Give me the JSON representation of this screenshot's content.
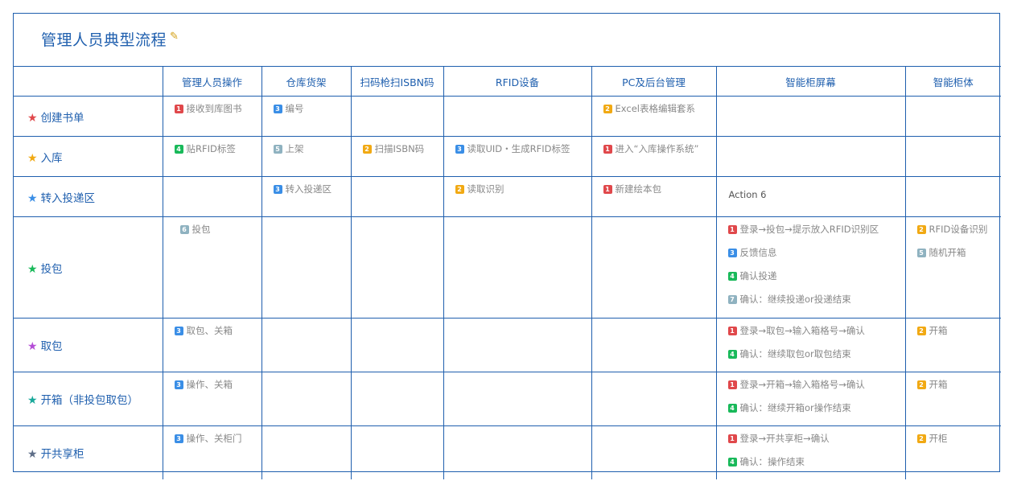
{
  "title": "管理人员典型流程",
  "columns": [
    "管理人员操作",
    "仓库货架",
    "扫码枪扫ISBN码",
    "RFID设备",
    "PC及后台管理",
    "智能柜屏幕",
    "智能柜体"
  ],
  "colors": {
    "red": "#e0484b",
    "orange": "#f1a913",
    "blue": "#3a8ee6",
    "green": "#19b95a",
    "grey": "#8fb2c0",
    "teal": "#19a89a",
    "purple": "#b44dd6",
    "slate": "#5e6e88"
  },
  "rows": [
    {
      "label": "创建书单",
      "star": "red",
      "cells": [
        [
          {
            "n": "1",
            "c": "red",
            "t": "接收到库图书"
          }
        ],
        [
          {
            "n": "3",
            "c": "blue",
            "t": "编号"
          }
        ],
        [],
        [],
        [
          {
            "n": "2",
            "c": "orange",
            "t": "Excel表格编辑套系"
          }
        ],
        [],
        []
      ]
    },
    {
      "label": "入库",
      "star": "orange",
      "cells": [
        [
          {
            "n": "4",
            "c": "green",
            "t": "贴RFID标签"
          }
        ],
        [
          {
            "n": "5",
            "c": "grey",
            "t": "上架"
          }
        ],
        [
          {
            "n": "2",
            "c": "orange",
            "t": "扫描ISBN码"
          }
        ],
        [
          {
            "n": "3",
            "c": "blue",
            "t": "读取UID・生成RFID标签"
          }
        ],
        [
          {
            "n": "1",
            "c": "red",
            "t": "进入“入库操作系统”"
          }
        ],
        [],
        []
      ]
    },
    {
      "label": "转入投递区",
      "star": "blue",
      "cells": [
        [],
        [
          {
            "n": "3",
            "c": "blue",
            "t": "转入投递区"
          }
        ],
        [],
        [
          {
            "n": "2",
            "c": "orange",
            "t": "读取识别"
          }
        ],
        [
          {
            "n": "1",
            "c": "red",
            "t": "新建绘本包"
          }
        ],
        [
          {
            "plain": "Action 6"
          }
        ],
        []
      ]
    },
    {
      "label": "投包",
      "star": "green",
      "cells": [
        [
          {
            "n": "6",
            "c": "grey",
            "t": "投包"
          }
        ],
        [],
        [],
        [],
        [],
        [
          {
            "n": "1",
            "c": "red",
            "t": "登录→投包→提示放入RFID识别区"
          },
          {
            "n": "3",
            "c": "blue",
            "t": "反馈信息"
          },
          {
            "n": "4",
            "c": "green",
            "t": "确认投递"
          },
          {
            "n": "7",
            "c": "grey",
            "t": "确认：继续投递or投递结束"
          }
        ],
        [
          {
            "n": "2",
            "c": "orange",
            "t": "RFID设备识别"
          },
          {
            "n": "5",
            "c": "grey",
            "t": "随机开箱"
          }
        ]
      ]
    },
    {
      "label": "取包",
      "star": "purple",
      "cells": [
        [
          {
            "n": "3",
            "c": "blue",
            "t": "取包、关箱"
          }
        ],
        [],
        [],
        [],
        [],
        [
          {
            "n": "1",
            "c": "red",
            "t": "登录→取包→输入箱格号→确认"
          },
          {
            "n": "4",
            "c": "green",
            "t": "确认：继续取包or取包结束"
          }
        ],
        [
          {
            "n": "2",
            "c": "orange",
            "t": "开箱"
          }
        ]
      ]
    },
    {
      "label": "开箱（非投包取包）",
      "star": "teal",
      "cells": [
        [
          {
            "n": "3",
            "c": "blue",
            "t": "操作、关箱"
          }
        ],
        [],
        [],
        [],
        [],
        [
          {
            "n": "1",
            "c": "red",
            "t": "登录→开箱→输入箱格号→确认"
          },
          {
            "n": "4",
            "c": "green",
            "t": "确认：继续开箱or操作结束"
          }
        ],
        [
          {
            "n": "2",
            "c": "orange",
            "t": "开箱"
          }
        ]
      ]
    },
    {
      "label": "开共享柜",
      "star": "slate",
      "cells": [
        [
          {
            "n": "3",
            "c": "blue",
            "t": "操作、关柜门"
          }
        ],
        [],
        [],
        [],
        [],
        [
          {
            "n": "1",
            "c": "red",
            "t": "登录→开共享柜→确认"
          },
          {
            "n": "4",
            "c": "green",
            "t": "确认：操作结束"
          }
        ],
        [
          {
            "n": "2",
            "c": "orange",
            "t": "开柜"
          }
        ]
      ]
    }
  ]
}
